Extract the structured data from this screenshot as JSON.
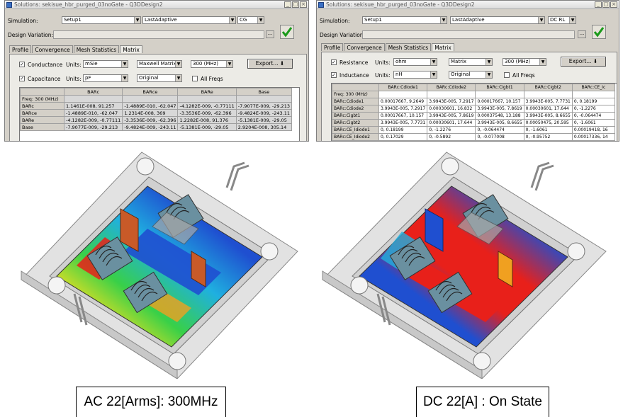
{
  "left_window": {
    "title": "Solutions: sekisue_hbr_purged_03noGate - Q3DDesign2",
    "simulation_label": "Simulation:",
    "setup_value": "Setup1",
    "pass_value": "LastAdaptive",
    "solution_type": "CG",
    "design_variation_label": "Design Variation:",
    "dots_label": "...",
    "tabs": [
      "Profile",
      "Convergence",
      "Mesh Statistics",
      "Matrix"
    ],
    "active_tab": "Matrix",
    "row1": {
      "check": "✓",
      "name": "Conductance",
      "units_label": "Units:",
      "units": "mSie",
      "matrix": "Maxwell Matrix",
      "freq": "300 (MHz)",
      "button": "Export..."
    },
    "row2": {
      "check": "✓",
      "name": "Capacitance",
      "units_label": "Units:",
      "units": "pF",
      "matrix": "Original",
      "allfreq": "All Freqs"
    },
    "grid": {
      "freq": "Freq: 300 (MHz)",
      "headers": [
        "BARc",
        "BARce",
        "BARe",
        "Base"
      ],
      "rows": [
        {
          "name": "BARc",
          "cells": [
            "1.1461E-008, 91.257",
            "-1.4889E-010, -62.047",
            "-4.1282E-009, -0.77111",
            "-7.9077E-009, -29.213"
          ]
        },
        {
          "name": "BARce",
          "cells": [
            "-1.4889E-010, -62.047",
            "1.2314E-008, 369",
            "-3.3536E-009, -62.396",
            "-9.4824E-009, -243.11"
          ]
        },
        {
          "name": "BARe",
          "cells": [
            "-4.1282E-009, -0.77111",
            "-3.3536E-009, -62.396",
            "1.2282E-008, 91.376",
            "-5.1381E-009, -29.05"
          ]
        },
        {
          "name": "Base",
          "cells": [
            "-7.9077E-009, -29.213",
            "-9.4824E-009, -243.11",
            "-5.1381E-009, -29.05",
            "2.9204E-008, 305.14"
          ]
        }
      ]
    }
  },
  "right_window": {
    "title": "Solutions: sekisue_hbr_purged_03noGate - Q3DDesign2",
    "simulation_label": "Simulation:",
    "setup_value": "Setup1",
    "pass_value": "LastAdaptive",
    "solution_type": "DC RL",
    "design_variation_label": "Design Variation:",
    "dots_label": "...",
    "tabs": [
      "Profile",
      "Convergence",
      "Mesh Statistics",
      "Matrix"
    ],
    "active_tab": "Matrix",
    "row1": {
      "check": "✓",
      "name": "Resistance",
      "units_label": "Units:",
      "units": "ohm",
      "matrix": "Matrix",
      "freq": "300 (MHz)",
      "button": "Export..."
    },
    "row2": {
      "check": "✓",
      "name": "Inductance",
      "units_label": "Units:",
      "units": "nH",
      "matrix": "Original",
      "allfreq": "All Freqs"
    },
    "grid": {
      "freq": "Freq: 300 (MHz)",
      "headers": [
        "BARc:Cdiode1",
        "BARc:Cdiode2",
        "BARc:Cigbt1",
        "BARc:Cigbt2",
        "BARc:CE_Ic"
      ],
      "rows": [
        {
          "name": "BARc:Cdiode1",
          "cells": [
            "0.00017667, 9.2649",
            "3.9943E-005, 7.2917",
            "0.00017667, 10.157",
            "3.9943E-005, 7.7731",
            "0, 0.18199"
          ]
        },
        {
          "name": "BARc:Cdiode2",
          "cells": [
            "3.9943E-005, 7.2917",
            "0.00030601, 16.832",
            "3.9943E-005, 7.8619",
            "0.00030601, 17.644",
            "0, -1.2276"
          ]
        },
        {
          "name": "BARc:Cigbt1",
          "cells": [
            "0.00017667, 10.157",
            "3.9943E-005, 7.8619",
            "0.00037548, 13.188",
            "3.9943E-005, 8.6655",
            "0, -0.064474"
          ]
        },
        {
          "name": "BARc:Cigbt2",
          "cells": [
            "3.9943E-005, 7.7731",
            "0.00030601, 17.644",
            "3.9943E-005, 8.6655",
            "0.00050475, 20.595",
            "0, -1.6061"
          ]
        },
        {
          "name": "BARc:CE_Idiode1",
          "cells": [
            "0, 0.18199",
            "0, -1.2276",
            "0, -0.064474",
            "0, -1.6061",
            "0.00019418, 16"
          ]
        },
        {
          "name": "BARc:CE_Idiode2",
          "cells": [
            "0, 0.17029",
            "0, -0.5892",
            "0, -0.077008",
            "0, -0.95752",
            "0.00017336, 14"
          ]
        }
      ]
    }
  },
  "captions": {
    "left": "AC 22[Arms]: 300MHz",
    "right": "DC 22[A] : On State"
  },
  "colors": {
    "window_bg": "#d4d0c8",
    "field_red": "#e8201a",
    "field_blue": "#1f4fd0",
    "field_green": "#38d048",
    "field_yellow": "#f0e020",
    "lead_brown": "#c85a28"
  }
}
